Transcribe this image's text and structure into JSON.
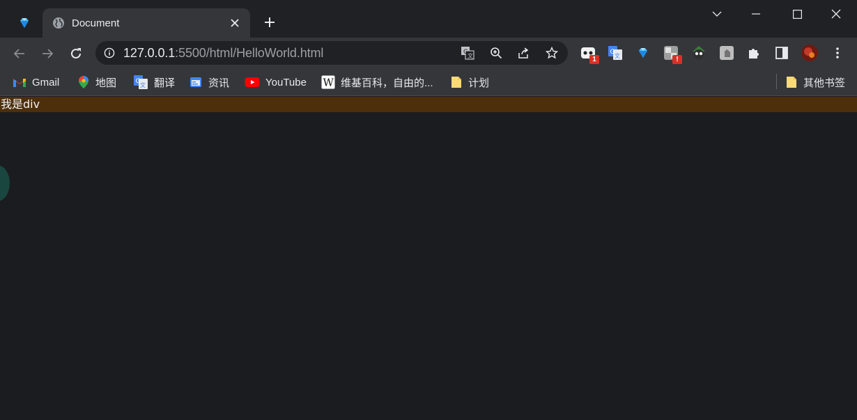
{
  "tabs": {
    "active_title": "Document"
  },
  "toolbar": {
    "url_host": "127.0.0.1",
    "url_rest": ":5500/html/HelloWorld.html"
  },
  "extensions": {
    "ext1_badge": "1",
    "ext4_badge": "!"
  },
  "bookmarks": {
    "items": [
      {
        "label": "Gmail"
      },
      {
        "label": "地图"
      },
      {
        "label": "翻译"
      },
      {
        "label": "资讯"
      },
      {
        "label": "YouTube"
      },
      {
        "label": "维基百科，自由的..."
      },
      {
        "label": "计划"
      }
    ],
    "other": "其他书签"
  },
  "page": {
    "div_text": "我是div"
  },
  "colors": {
    "tabstrip_bg": "#202124",
    "toolbar_bg": "#35363a",
    "page_bg": "#1b1c1f",
    "div_bg": "#4d2f0c"
  }
}
